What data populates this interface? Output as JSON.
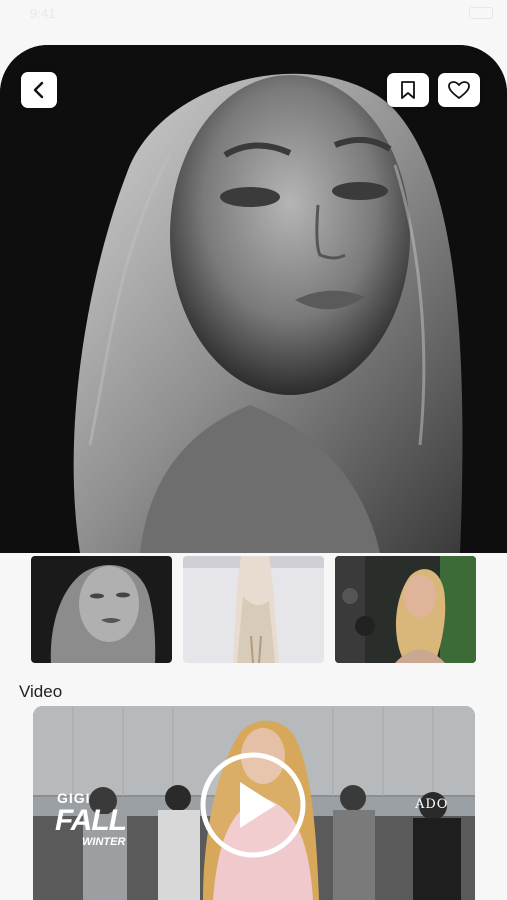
{
  "status_bar": {
    "time": "9:41"
  },
  "hero": {
    "actions": {
      "back": "back",
      "bookmark": "bookmark",
      "like": "like"
    }
  },
  "gallery": {
    "thumbnails": [
      "portrait",
      "runway",
      "event"
    ]
  },
  "video_section": {
    "title": "Video",
    "overlay": {
      "gigi": "GIGI",
      "fall": "FALL",
      "winter": "WINTER",
      "brand": "ADO"
    }
  },
  "colors": {
    "background": "#f7f7f7",
    "hero_background": "#101010",
    "button_background": "#ffffff",
    "icon_stroke": "#111111"
  },
  "icons": {
    "back": "chevron-left-icon",
    "bookmark": "bookmark-icon",
    "like": "heart-icon",
    "play": "play-icon"
  }
}
